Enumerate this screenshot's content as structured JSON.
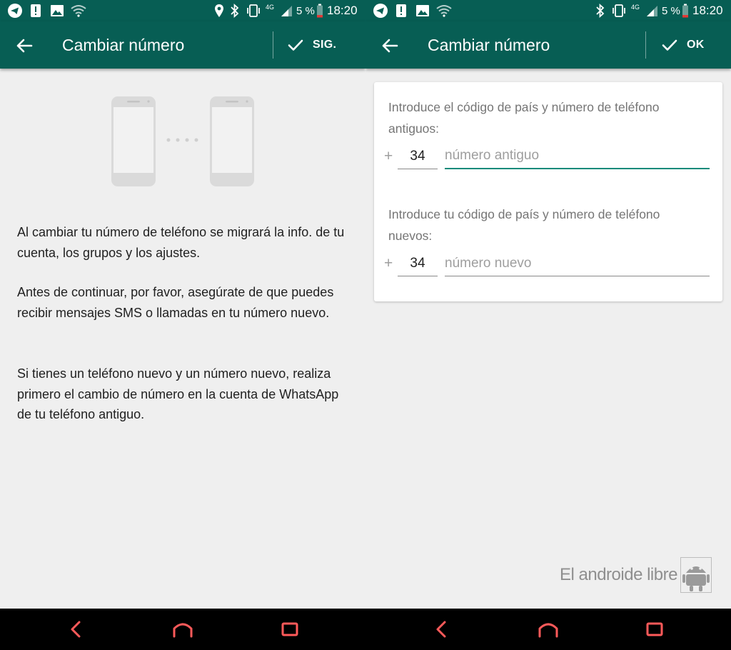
{
  "status_bar": {
    "left": {
      "battery": "5 %",
      "network": "4G",
      "time": "18:20"
    },
    "right": {
      "battery": "5 %",
      "network": "4G",
      "time": "18:20"
    }
  },
  "left_screen": {
    "title": "Cambiar número",
    "action_label": "SIG.",
    "paragraphs": [
      "Al cambiar tu número de teléfono se migrará la info. de tu cuenta, los grupos y los ajustes.",
      "Antes de continuar, por favor, asegúrate de que puedes recibir mensajes SMS o llamadas en tu número nuevo.",
      "Si tienes un teléfono nuevo y un número nuevo, realiza primero el cambio de número en la cuenta de WhatsApp de tu teléfono antiguo."
    ]
  },
  "right_screen": {
    "title": "Cambiar número",
    "action_label": "OK",
    "old_label": "Introduce el código de país y número de teléfono antiguos:",
    "old_plus": "+",
    "old_country_code": "34",
    "old_number_placeholder": "número antiguo",
    "new_label": "Introduce tu código de país y número de teléfono nuevos:",
    "new_plus": "+",
    "new_country_code": "34",
    "new_number_placeholder": "número nuevo"
  },
  "watermark": {
    "text": "El androide libre"
  },
  "colors": {
    "toolbar": "#075e54",
    "background": "#efefef",
    "focus_accent": "#0f8a7a",
    "nav_icons": "#ff5a5a"
  },
  "icons": {
    "status_left": [
      "telegram-icon",
      "alert-icon",
      "image-icon",
      "wifi-icon"
    ],
    "status_right": [
      "location-icon",
      "bluetooth-icon",
      "vibrate-icon",
      "signal-icon",
      "battery-icon"
    ],
    "toolbar": [
      "back-arrow-icon",
      "check-icon"
    ],
    "navigation": [
      "nav-back-icon",
      "nav-home-icon",
      "nav-recents-icon"
    ]
  }
}
